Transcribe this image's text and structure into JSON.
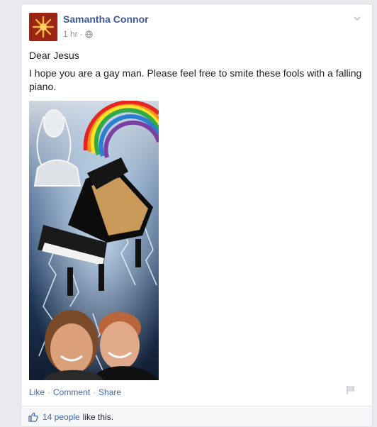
{
  "post": {
    "author": "Samantha Connor",
    "time": "1 hr",
    "time_separator": "·",
    "privacy_icon": "globe-icon",
    "menu_icon": "chevron-down-icon",
    "paragraphs": [
      "Dear Jesus",
      "I hope you are a gay man. Please feel free to smite these fools with a falling piano."
    ]
  },
  "actions": {
    "like": "Like",
    "comment": "Comment",
    "share": "Share",
    "separator": "·"
  },
  "likes": {
    "people": "14 people",
    "suffix": "like this."
  },
  "colors": {
    "link": "#4267b2",
    "author": "#3b5998",
    "background": "#e9eaed",
    "card": "#ffffff"
  }
}
